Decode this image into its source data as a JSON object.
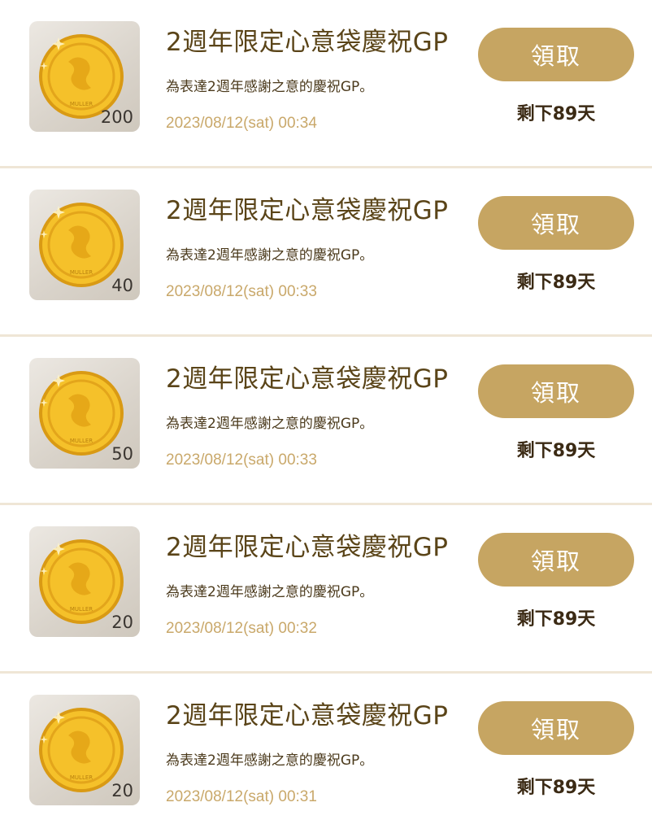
{
  "items": [
    {
      "title": "2週年限定心意袋慶祝GP",
      "description": "為表達2週年感謝之意的慶祝GP。",
      "date": "2023/08/12(sat) 00:34",
      "quantity": "200",
      "claim_label": "領取",
      "remaining": "剩下89天",
      "icon": "gold-coin-icon"
    },
    {
      "title": "2週年限定心意袋慶祝GP",
      "description": "為表達2週年感謝之意的慶祝GP。",
      "date": "2023/08/12(sat) 00:33",
      "quantity": "40",
      "claim_label": "領取",
      "remaining": "剩下89天",
      "icon": "gold-coin-icon"
    },
    {
      "title": "2週年限定心意袋慶祝GP",
      "description": "為表達2週年感謝之意的慶祝GP。",
      "date": "2023/08/12(sat) 00:33",
      "quantity": "50",
      "claim_label": "領取",
      "remaining": "剩下89天",
      "icon": "gold-coin-icon"
    },
    {
      "title": "2週年限定心意袋慶祝GP",
      "description": "為表達2週年感謝之意的慶祝GP。",
      "date": "2023/08/12(sat) 00:32",
      "quantity": "20",
      "claim_label": "領取",
      "remaining": "剩下89天",
      "icon": "gold-coin-icon"
    },
    {
      "title": "2週年限定心意袋慶祝GP",
      "description": "為表達2週年感謝之意的慶祝GP。",
      "date": "2023/08/12(sat) 00:31",
      "quantity": "20",
      "claim_label": "領取",
      "remaining": "剩下89天",
      "icon": "gold-coin-icon"
    }
  ],
  "colors": {
    "title": "#5a4418",
    "date": "#c9a86a",
    "claim_button": "#c6a562",
    "divider": "#efe6d6"
  }
}
